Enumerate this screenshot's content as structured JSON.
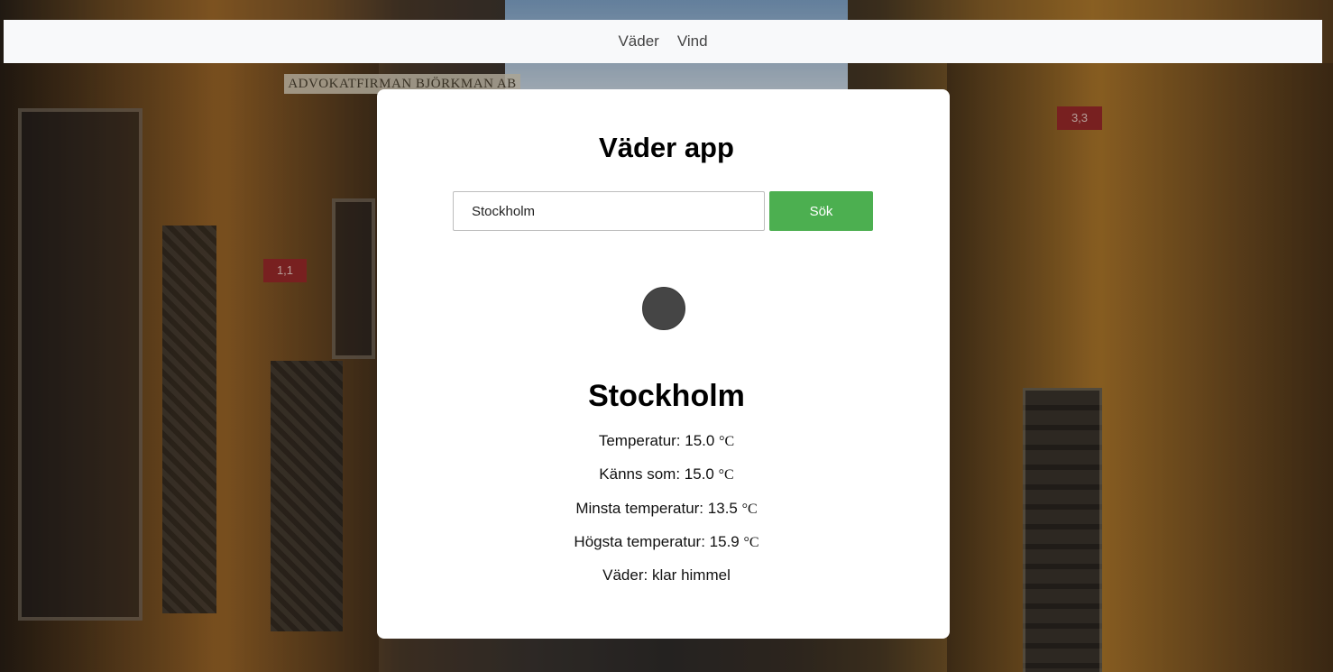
{
  "nav": {
    "items": [
      {
        "label": "Väder"
      },
      {
        "label": "Vind"
      }
    ]
  },
  "background": {
    "sign_text": "ADVOKATFIRMAN BJÖRKMAN AB",
    "plate_left": "1,1",
    "plate_right": "3,3"
  },
  "app": {
    "title": "Väder app",
    "search": {
      "value": "Stockholm",
      "button_label": "Sök"
    },
    "weather_icon": "weather-icon",
    "result": {
      "city": "Stockholm",
      "rows": [
        {
          "label": "Temperatur:",
          "value": "15.0",
          "unit": "°C"
        },
        {
          "label": "Känns som:",
          "value": "15.0",
          "unit": "°C"
        },
        {
          "label": "Minsta temperatur:",
          "value": "13.5",
          "unit": "°C"
        },
        {
          "label": "Högsta temperatur:",
          "value": "15.9",
          "unit": "°C"
        }
      ],
      "description_label": "Väder:",
      "description": "klar himmel"
    }
  },
  "colors": {
    "button_bg": "#4caf50",
    "navbar_bg": "#f8f9fa",
    "card_bg": "#ffffff"
  }
}
